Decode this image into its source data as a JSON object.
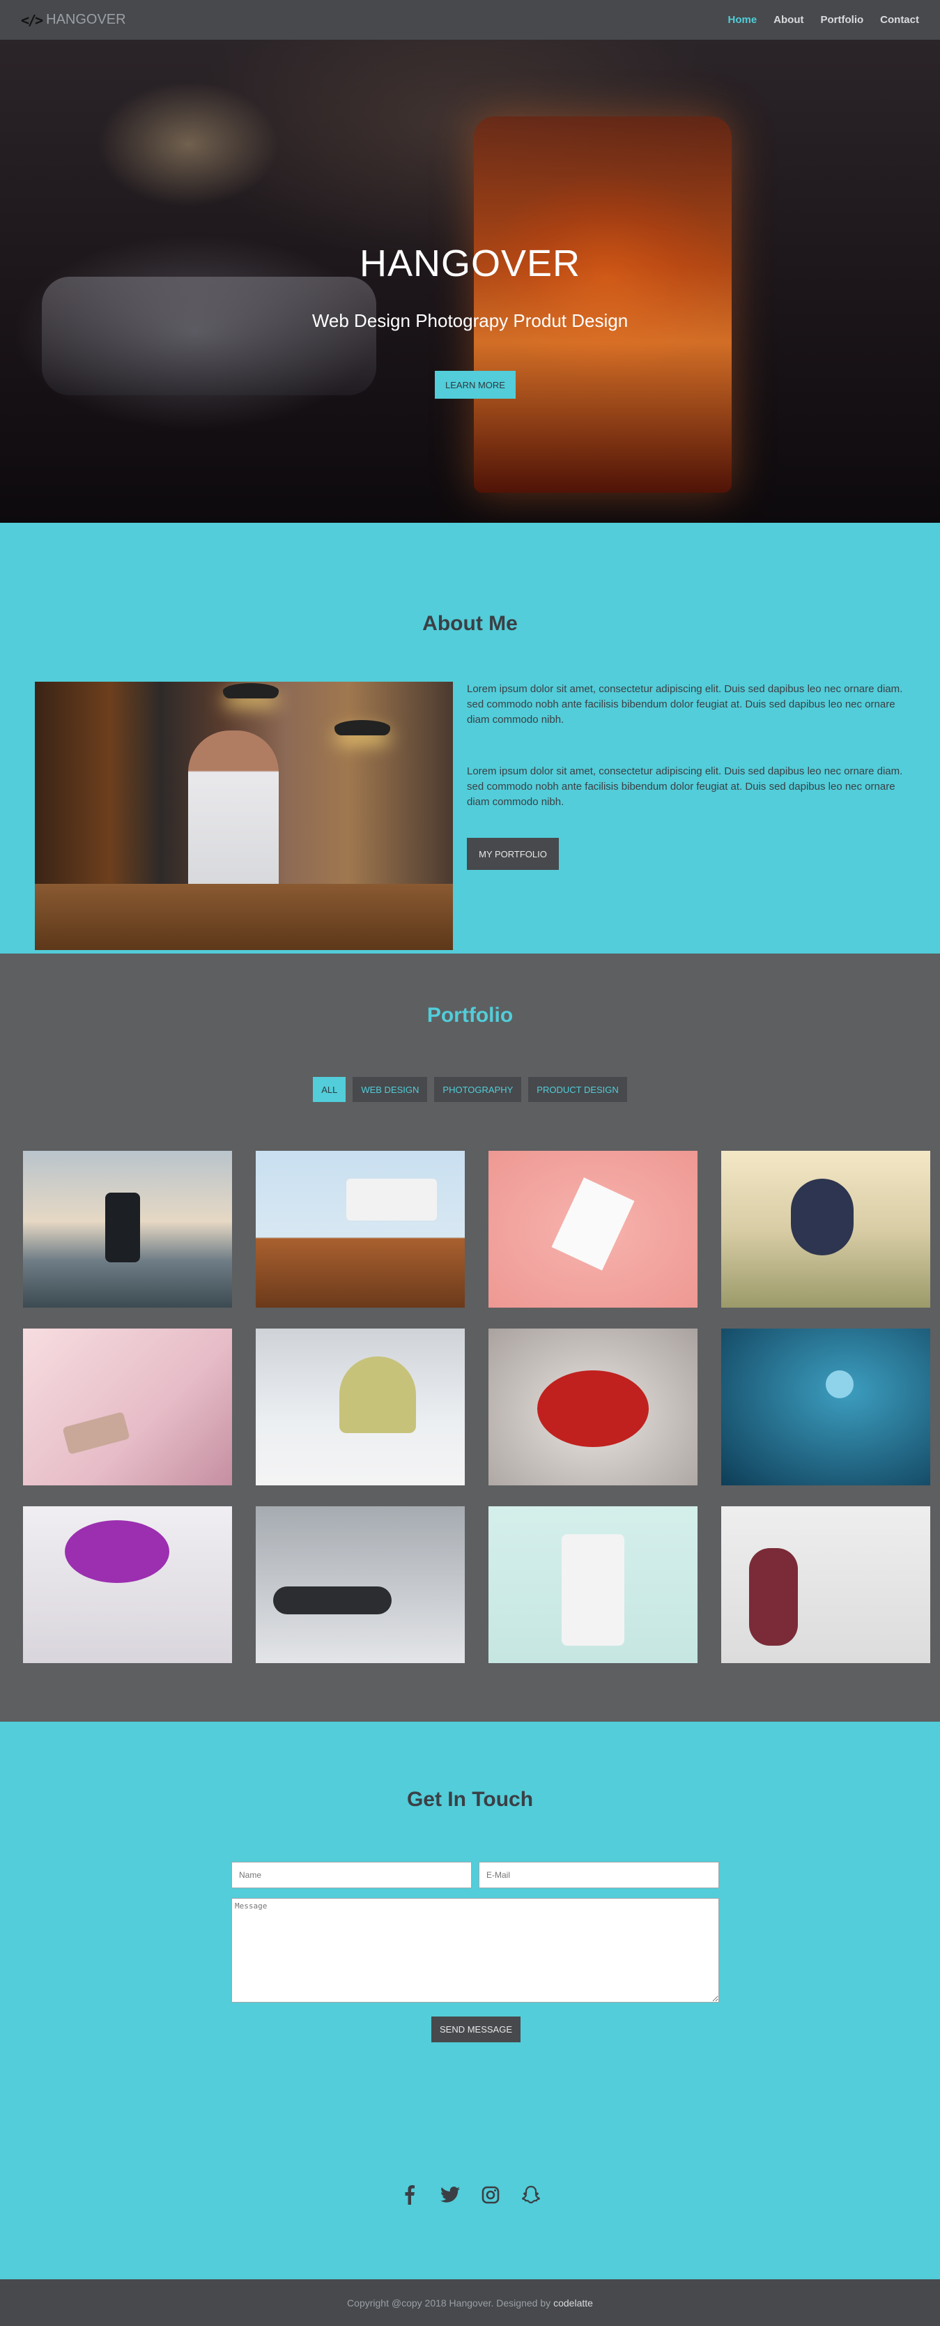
{
  "nav": {
    "brand_icon": "</>",
    "brand": "HANGOVER",
    "links": [
      "Home",
      "About",
      "Portfolio",
      "Contact"
    ]
  },
  "hero": {
    "title": "HANGOVER",
    "subtitle": "Web Design Photograpy Produt Design",
    "button": "LEARN MORE"
  },
  "about": {
    "title": "About Me",
    "paragraphs": [
      "Lorem ipsum dolor sit amet, consectetur adipiscing elit. Duis sed dapibus leo nec ornare diam. sed commodo nobh ante facilisis bibendum dolor feugiat at. Duis sed dapibus leo nec ornare diam commodo nibh.",
      "Lorem ipsum dolor sit amet, consectetur adipiscing elit. Duis sed dapibus leo nec ornare diam. sed commodo nobh ante facilisis bibendum dolor feugiat at. Duis sed dapibus leo nec ornare diam commodo nibh."
    ],
    "button": "MY PORTFOLIO"
  },
  "portfolio": {
    "title": "Portfolio",
    "filters": [
      "ALL",
      "WEB DESIGN",
      "PHOTOGRAPHY",
      "PRODUCT DESIGN"
    ],
    "active_filter": "ALL"
  },
  "contact": {
    "title": "Get In Touch",
    "name_placeholder": "Name",
    "email_placeholder": "E-Mail",
    "message_placeholder": "Message",
    "button": "SEND MESSAGE"
  },
  "socials": [
    "facebook-icon",
    "twitter-icon",
    "instagram-icon",
    "snapchat-icon"
  ],
  "footer": {
    "text": "Copyright @copy 2018 Hangover. Designed by",
    "link": "codelatte"
  },
  "colors": {
    "accent": "#52cdd9",
    "dark": "#47494c",
    "portfolio_bg": "#5e5f61"
  }
}
